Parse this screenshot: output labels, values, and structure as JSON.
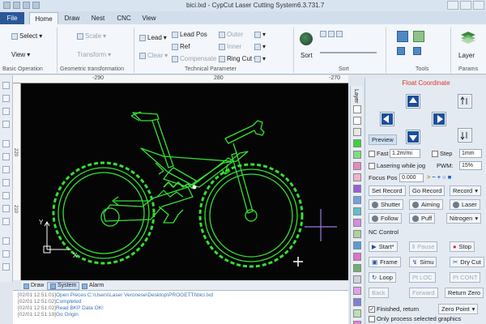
{
  "window": {
    "title": "bici.lxd - CypCut Laser Cutting System6.3.731.7"
  },
  "tabs": [
    "File",
    "Home",
    "Draw",
    "Nest",
    "CNC",
    "View"
  ],
  "ribbon": {
    "select": "Select",
    "view": "View",
    "scale": "Scale",
    "transform": "Transform",
    "lead": "Lead",
    "clear": "Clear",
    "lead_pos": "Lead Pos",
    "ref": "Ref",
    "compensate": "Compensate",
    "outer": "Outer",
    "inner": "Inner",
    "ring_cut": "Ring Cut",
    "sort": "Sort",
    "layer": "Layer",
    "groups": {
      "basic_operation": "Basic Operation",
      "geometric_transformation": "Geometric transformation",
      "technical_parameter": "Technical Parameter",
      "sort": "Sort",
      "tools": "Tools",
      "params": "Params"
    }
  },
  "rulers": {
    "top": [
      "-290",
      "280",
      "-270"
    ],
    "left": [
      "220",
      "210"
    ]
  },
  "canvas": {
    "axis_y": "Y",
    "axis_x": "X",
    "outline_color": "#35e035",
    "background": "#050505"
  },
  "bottom_tabs": [
    "Draw",
    "System",
    "Alarm"
  ],
  "log": [
    {
      "time": "[02/01 12:51:01]",
      "msg": "Open Pieces:C:\\Users\\Laser Veronese\\Desktop\\PROGETTI\\bici.lxd"
    },
    {
      "time": "[02/01 12:51:02]",
      "msg": "Completed"
    },
    {
      "time": "[02/01 12:51:02]",
      "msg": "Read BKP Data OK!"
    },
    {
      "time": "[02/01 12:51:19]",
      "msg": "Go Origin"
    }
  ],
  "layer_strip": {
    "label": "Layer",
    "colors": [
      "#ffffff",
      "#ffffff",
      "#e8e8e8",
      "#3ad43a",
      "#7fdc7f",
      "#e68ac0",
      "#f1b0d0",
      "#9a5fd8",
      "#6fa3e0",
      "#5ec0c8",
      "#d98ae0",
      "#b0d0a0",
      "#5a9ad8",
      "#e070d0",
      "#70b070",
      "#d0d0e0",
      "#e0a0e8",
      "#8080d0",
      "#b8e0b8",
      "#e880d8"
    ]
  },
  "panel": {
    "header": "Float Coordinate",
    "preview": "Preview",
    "fast": "Fast",
    "fast_value": "1.2m/mi",
    "step": "Step",
    "step_value": "1mm",
    "lasering_while_jog": "Lasering while jog",
    "pwm": "PWM:",
    "pwm_value": "15%",
    "focus_pos": "Focus Pos",
    "focus_value": "0.000",
    "set_record": "Set Record",
    "go_record": "Go Record",
    "record": "Record",
    "shutter": "Shutter",
    "aiming": "Aiming",
    "laser": "Laser",
    "follow": "Follow",
    "puff": "Puff",
    "nitrogen": "Nitrogen",
    "nc_control": "NC Control",
    "start": "Start*",
    "pause": "Pause",
    "stop": "Stop",
    "frame": "Frame",
    "simu": "Simu",
    "dry_cut": "Dry Cut",
    "loop": "Loop",
    "pt_loc": "Pt LOC",
    "pt_cont": "Pt CONT",
    "back": "Back",
    "forward": "Forward",
    "return_zero": "Return Zero",
    "finished_return": "Finished, return",
    "zero_point": "Zero Point",
    "only_process_selected": "Only process selected graphics"
  }
}
